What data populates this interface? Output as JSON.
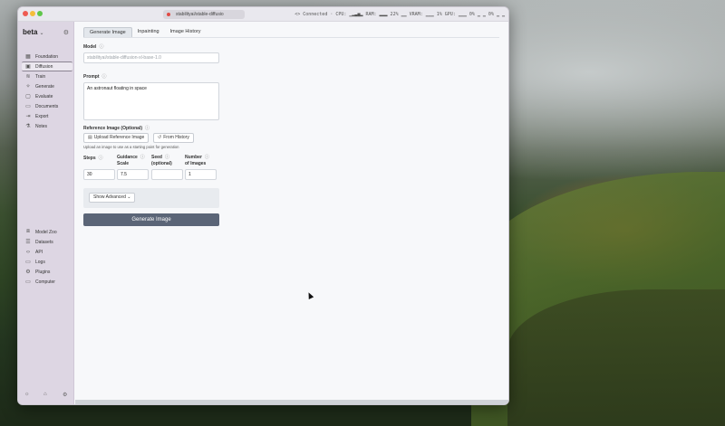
{
  "titlebar": {
    "tab_title": "stabilityai/stable-diffusio",
    "status": "<> Connected · CPU: ▁▂▃▅▂ RAM: ▂▂▂ 22% ▁▁ VRAM: ▁▁▁ 1% GPU: ▁▁▁ 0% ▁ ▁ 0% ▁ ▁"
  },
  "sidebar": {
    "workspace": "beta",
    "items": [
      {
        "label": "Foundation",
        "icon": "grid-icon"
      },
      {
        "label": "Diffusion",
        "icon": "image-icon"
      },
      {
        "label": "Train",
        "icon": "layers-icon"
      },
      {
        "label": "Generate",
        "icon": "sparkle-icon"
      },
      {
        "label": "Evaluate",
        "icon": "document-check-icon"
      },
      {
        "label": "Documents",
        "icon": "file-icon"
      },
      {
        "label": "Export",
        "icon": "export-icon"
      },
      {
        "label": "Notes",
        "icon": "flask-icon"
      }
    ],
    "bottom_items": [
      {
        "label": "Model Zoo",
        "icon": "box-icon"
      },
      {
        "label": "Datasets",
        "icon": "database-icon"
      },
      {
        "label": "API",
        "icon": "code-icon"
      },
      {
        "label": "Logs",
        "icon": "terminal-icon"
      },
      {
        "label": "Plugins",
        "icon": "plugin-icon"
      },
      {
        "label": "Computer",
        "icon": "monitor-icon"
      }
    ],
    "active_index": 1
  },
  "main": {
    "tabs": [
      "Generate Image",
      "Inpainting",
      "Image History"
    ],
    "active_tab": 0,
    "model_label": "Model",
    "model_value": "stabilityai/stable-diffusion-xl-base-1.0",
    "prompt_label": "Prompt",
    "prompt_value": "An astronaut floating in space",
    "ref_label": "Reference Image (Optional)",
    "upload_label": "Upload Reference Image",
    "history_label": "From History",
    "ref_hint": "Upload an image to use as a starting point for generation",
    "steps_label": "Steps",
    "steps_value": "30",
    "guidance_label_1": "Guidance",
    "guidance_label_2": "Scale",
    "guidance_value": "7.5",
    "seed_label_1": "Seed",
    "seed_label_2": "(optional)",
    "seed_value": "",
    "num_label_1": "Number",
    "num_label_2": "of Images",
    "num_value": "1",
    "advanced_label": "Show Advanced",
    "generate_label": "Generate Image"
  },
  "colors": {
    "sidebar_bg": "#ddd6e3",
    "primary_button": "#5b6577"
  }
}
